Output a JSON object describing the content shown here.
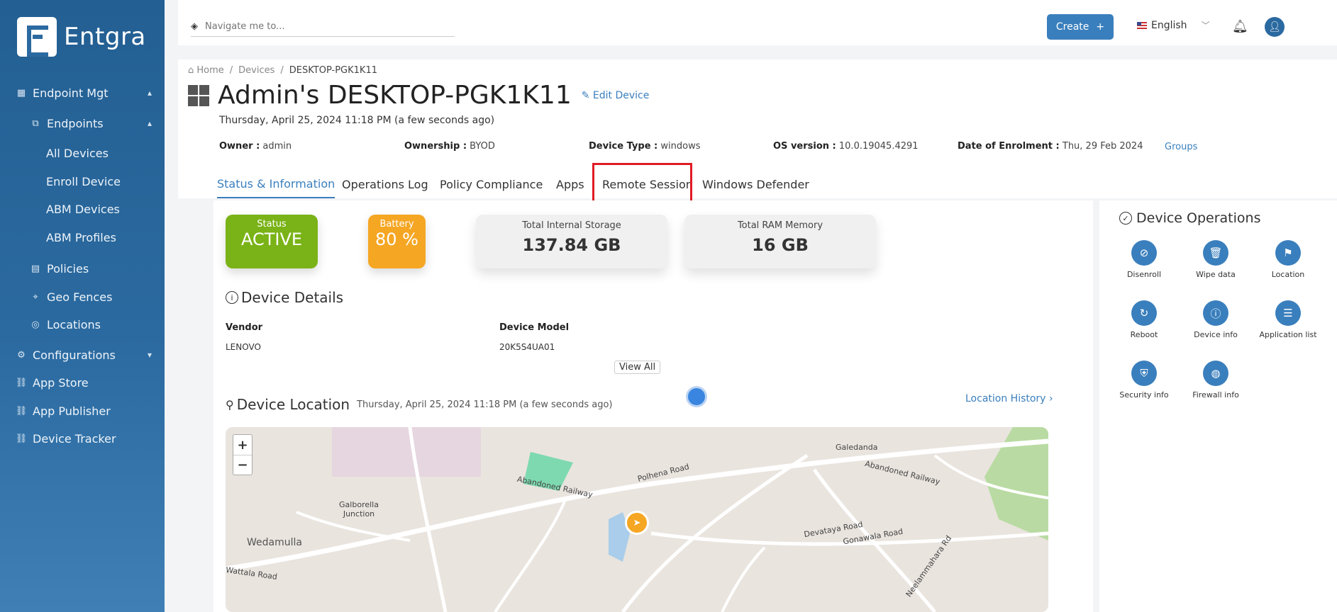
{
  "brand": {
    "name": "Entgra"
  },
  "sidebar": {
    "items": [
      {
        "label": "Endpoint Mgt",
        "icon": "grid-icon",
        "chevron": "▴"
      },
      {
        "label": "Endpoints",
        "icon": "devices-icon",
        "chevron": "▴"
      },
      {
        "label": "All Devices"
      },
      {
        "label": "Enroll Device"
      },
      {
        "label": "ABM Devices"
      },
      {
        "label": "ABM Profiles"
      },
      {
        "label": "Policies",
        "icon": "policy-icon"
      },
      {
        "label": "Geo Fences",
        "icon": "geofence-icon"
      },
      {
        "label": "Locations",
        "icon": "location-pin-icon"
      },
      {
        "label": "Configurations",
        "icon": "gear-icon",
        "chevron": "▾"
      },
      {
        "label": "App Store",
        "icon": "link-icon"
      },
      {
        "label": "App Publisher",
        "icon": "link-icon"
      },
      {
        "label": "Device Tracker",
        "icon": "link-icon"
      }
    ]
  },
  "topbar": {
    "search_placeholder": "Navigate me to...",
    "create_label": "Create",
    "language": "English"
  },
  "breadcrumb": {
    "home": "Home",
    "devices": "Devices",
    "current": "DESKTOP-PGK1K11"
  },
  "device": {
    "title": "Admin's DESKTOP-PGK1K11",
    "edit_label": "Edit Device",
    "timestamp": "Thursday, April 25, 2024 11:18 PM (a few seconds ago)",
    "owner_label": "Owner :",
    "owner": "admin",
    "ownership_label": "Ownership :",
    "ownership": "BYOD",
    "type_label": "Device Type :",
    "type": "windows",
    "os_label": "OS version :",
    "os": "10.0.19045.4291",
    "enrol_label": "Date of Enrolment :",
    "enrol": "Thu, 29 Feb 2024",
    "groups_label": "Groups"
  },
  "tabs": [
    "Status & Information",
    "Operations Log",
    "Policy Compliance",
    "Apps",
    "Remote Session",
    "Windows Defender"
  ],
  "status": {
    "status_label": "Status",
    "status_value": "ACTIVE",
    "status_color": "#7ab317",
    "battery_label": "Battery",
    "battery_value": "80 %",
    "battery_color": "#f5a623",
    "storage_label": "Total Internal Storage",
    "storage_value": "137.84 GB",
    "ram_label": "Total RAM Memory",
    "ram_value": "16 GB"
  },
  "details": {
    "title": "Device Details",
    "vendor_label": "Vendor",
    "vendor": "LENOVO",
    "model_label": "Device Model",
    "model": "20K5S4UA01",
    "view_all": "View All"
  },
  "location": {
    "title": "Device Location",
    "timestamp": "Thursday, April 25, 2024 11:18 PM (a few seconds ago)",
    "history_label": "Location History",
    "map_labels": [
      "Wedamulla",
      "Galborella Junction",
      "Abandoned Railway",
      "Polhena Road",
      "Galedanda",
      "Abandoned Railway",
      "Devataya Road",
      "Gonawala Road",
      "Neelammahara Rd",
      "Wattala Road"
    ]
  },
  "operations": {
    "title": "Device Operations",
    "items": [
      {
        "label": "Disenroll",
        "icon": "ban-icon"
      },
      {
        "label": "Wipe data",
        "icon": "trash-icon"
      },
      {
        "label": "Location",
        "icon": "map-icon"
      },
      {
        "label": "Reboot",
        "icon": "reboot-icon"
      },
      {
        "label": "Device info",
        "icon": "info-icon"
      },
      {
        "label": "Application list",
        "icon": "list-icon"
      },
      {
        "label": "Security info",
        "icon": "shield-icon"
      },
      {
        "label": "Firewall info",
        "icon": "globe-icon"
      }
    ]
  }
}
